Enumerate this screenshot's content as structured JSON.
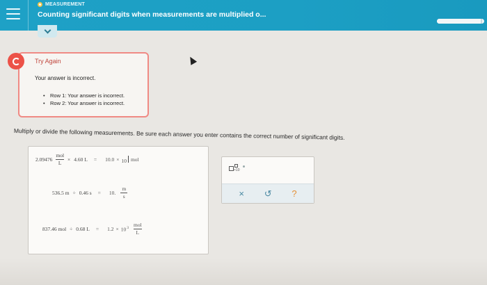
{
  "header": {
    "menu_icon": "hamburger-icon",
    "breadcrumb": "MEASUREMENT",
    "title": "Counting significant digits when measurements are multiplied o...",
    "progress": 0.96,
    "expand_icon": "chevron-down-icon",
    "colors": {
      "bar": "#1ea1c6",
      "breadcrumb_dot": "#f6c64a"
    }
  },
  "feedback": {
    "icon": "retry-icon",
    "heading": "Try Again",
    "message": "Your answer is incorrect.",
    "rows": [
      "Row 1: Your answer is incorrect.",
      "Row 2: Your answer is incorrect."
    ],
    "colors": {
      "accent": "#ec5248",
      "border": "#f08a84"
    }
  },
  "instructions": "Multiply or divide the following measurements. Be sure each answer you enter contains the correct number of significant digits.",
  "problems": [
    {
      "coefficient": "2.09476",
      "unit_num": "mol",
      "unit_den": "L",
      "operator": "×",
      "operand": "4.60 L",
      "equals": "=",
      "answer_value": "10.0",
      "times": "×",
      "base": "10",
      "exponent": "",
      "answer_unit": "mol"
    },
    {
      "left": "536.5 m",
      "operator": "÷",
      "operand": "0.46 s",
      "equals": "=",
      "answer_value": "10.",
      "unit_num": "m",
      "unit_den": "s"
    },
    {
      "left": "837.46 mol",
      "operator": "÷",
      "operand": "0.68 L",
      "equals": "=",
      "answer_value": "1.2",
      "times": "×",
      "base": "10",
      "exponent": "3",
      "unit_num": "mol",
      "unit_den": "L"
    }
  ],
  "tools": {
    "scientific_notation_icon": "superscript-box-icon",
    "clear": "×",
    "undo": "↺",
    "help": "?"
  }
}
